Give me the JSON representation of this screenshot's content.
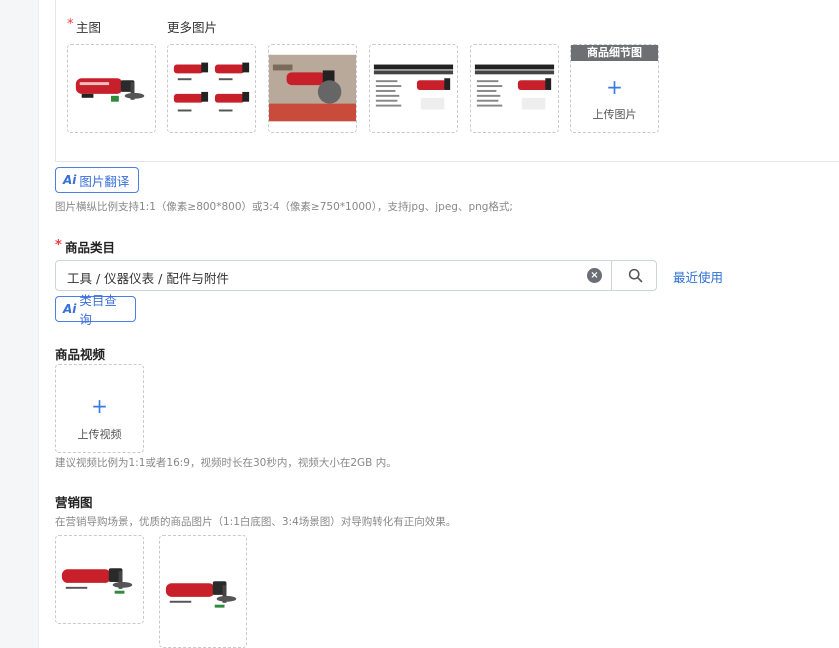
{
  "images": {
    "main_label": "主图",
    "more_label": "更多图片",
    "required_mark": "*",
    "detail": {
      "header": "商品细节图",
      "plus": "+",
      "upload_text": "上传图片"
    },
    "spec_card_lines": [
      "Electric Angle Grinder",
      "4寸砂轮机 角磨 850W"
    ],
    "ai_translate_label": "图片翻译",
    "ai_mark": "Ai",
    "hint": "图片横纵比例支持1:1（像素≥800*800）或3:4（像素≥750*1000），支持jpg、jpeg、png格式;"
  },
  "category": {
    "required_mark": "*",
    "label": "商品类目",
    "value": "工具 / 仪器仪表 / 配件与附件",
    "clear_icon": "×",
    "recent_link": "最近使用",
    "ai_query_label": "类目查询",
    "ai_mark": "Ai"
  },
  "video": {
    "label": "商品视频",
    "plus": "+",
    "upload_text": "上传视频",
    "hint": "建议视频比例为1:1或者16:9，视频时长在30秒内，视频大小在2GB 内。"
  },
  "marketing": {
    "label": "营销图",
    "hint": "在营销导购场景，优质的商品图片（1:1白底图、3:4场景图）对导购转化有正向效果。"
  },
  "theme": {
    "accent": "#3a6fd8",
    "required": "#ee3b3b",
    "product_red": "#c8202a"
  },
  "icons": {
    "search": "search-icon",
    "clear": "clear-icon",
    "plus": "plus-icon",
    "ai": "ai-icon"
  }
}
